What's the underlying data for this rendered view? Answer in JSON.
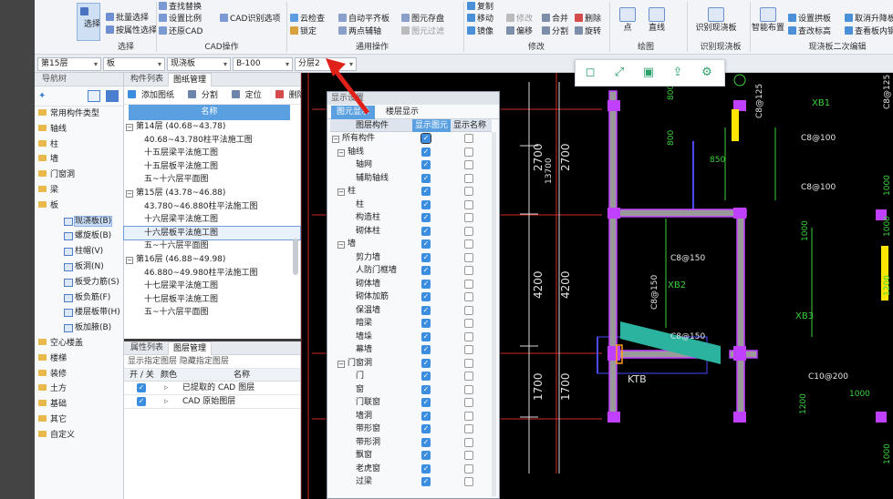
{
  "ribbon": {
    "select": {
      "label": "选择"
    },
    "col1": [
      "批量选择",
      "按属性选择"
    ],
    "col2": [
      "查找替换",
      "设置比例",
      "还原CAD"
    ],
    "col3": [
      "CAD识别选项"
    ],
    "col4": [
      "云检查",
      "锁定"
    ],
    "col5": [
      "自动平齐板",
      "两点辅轴"
    ],
    "col6": [
      "图元存盘",
      "图元过滤"
    ],
    "col7": [
      "复制",
      "移动",
      "镜像"
    ],
    "col8": [
      "修改",
      "偏移"
    ],
    "col9": [
      "合并",
      "分割"
    ],
    "col10": [
      "删除",
      "旋转"
    ],
    "draw": [
      "点",
      "直线"
    ],
    "idslab": "识别现浇板",
    "smart": "智能布置",
    "col11": [
      "设置拱板",
      "查改标高"
    ],
    "col12": [
      "取消升降板",
      "查看板内钢筋"
    ],
    "groups": {
      "select": "选择",
      "cad": "CAD操作",
      "common": "通用操作",
      "modify": "修改",
      "draw": "绘图",
      "idslab": "识别现浇板",
      "slab2": "现浇板二次编辑"
    }
  },
  "toolbar": {
    "floor": "第15层",
    "type": "板",
    "subtype": "现浇板",
    "code": "B-100",
    "layer": "分层2"
  },
  "nav": {
    "title": "导航树",
    "items": [
      "常用构件类型",
      "轴线",
      "柱",
      "墙",
      "门窗洞",
      "梁",
      "板"
    ],
    "slab_children": [
      "现浇板(B)",
      "螺旋板(B)",
      "柱帽(V)",
      "板洞(N)",
      "板受力筋(S)",
      "板负筋(F)",
      "楼层板带(H)",
      "板加腋(B)"
    ],
    "after": [
      "空心楼盖",
      "楼梯",
      "装修",
      "土方",
      "基础",
      "其它",
      "自定义"
    ]
  },
  "comp": {
    "tabs": [
      "构件列表",
      "图纸管理"
    ],
    "tools": [
      "添加图纸",
      "分割",
      "定位",
      "删除"
    ],
    "col": "名称",
    "groups": [
      {
        "name": "第14层 (40.68~43.78)",
        "items": [
          "40.68~43.780柱平法施工图",
          "十五层梁平法施工图",
          "十五层板平法施工图",
          "五~十六层平面图"
        ]
      },
      {
        "name": "第15层 (43.78~46.88)",
        "items": [
          "43.780~46.880柱平法施工图",
          "十六层梁平法施工图",
          "十六层板平法施工图",
          "五~十六层平面图"
        ]
      },
      {
        "name": "第16层 (46.88~49.98)",
        "items": [
          "46.880~49.980柱平法施工图",
          "十七层梁平法施工图",
          "十七层板平法施工图",
          "五~十六层平面图"
        ]
      }
    ]
  },
  "layer": {
    "tabs": [
      "属性列表",
      "图层管理"
    ],
    "links": [
      "显示指定图层",
      "隐藏指定图层"
    ],
    "headers": [
      "开 / 关",
      "颜色",
      "名称"
    ],
    "rows": [
      "已提取的 CAD 图层",
      "CAD 原始图层"
    ]
  },
  "display": {
    "title": "显示设置",
    "tabs": [
      "图元显示",
      "楼层显示"
    ],
    "headers": [
      "图层构件",
      "显示图元",
      "显示名称"
    ],
    "rows": [
      {
        "t": "所有构件",
        "cat": true
      },
      {
        "t": "轴线",
        "cat": true
      },
      {
        "t": "轴网"
      },
      {
        "t": "辅助轴线"
      },
      {
        "t": "柱",
        "cat": true
      },
      {
        "t": "柱"
      },
      {
        "t": "构造柱"
      },
      {
        "t": "砌体柱"
      },
      {
        "t": "墙",
        "cat": true
      },
      {
        "t": "剪力墙"
      },
      {
        "t": "人防门框墙"
      },
      {
        "t": "砌体墙"
      },
      {
        "t": "砌体加筋"
      },
      {
        "t": "保温墙"
      },
      {
        "t": "暗梁"
      },
      {
        "t": "墙垛"
      },
      {
        "t": "幕墙"
      },
      {
        "t": "门窗洞",
        "cat": true
      },
      {
        "t": "门"
      },
      {
        "t": "窗"
      },
      {
        "t": "门联窗"
      },
      {
        "t": "墙洞"
      },
      {
        "t": "带形窗"
      },
      {
        "t": "带形洞"
      },
      {
        "t": "飘窗"
      },
      {
        "t": "老虎窗"
      },
      {
        "t": "过梁"
      }
    ]
  },
  "cad": {
    "labels": {
      "d2700a": "2700",
      "d2700b": "2700",
      "d13": "13700",
      "d4200a": "4200",
      "d4200b": "4200",
      "d1700a": "1700",
      "d1700b": "1700",
      "xb1": "XB1",
      "xb2": "XB2",
      "xb3": "XB3",
      "ktb": "KTB",
      "c8a": "C8@100",
      "c8b": "C8@100",
      "c8c": "C8@150",
      "c8d": "C8@150",
      "c8e": "C8@150",
      "c8f": "C8@125",
      "c8g": "C8@125",
      "c10": "C10@200",
      "y800a": "800",
      "y850": "850",
      "y800b": "800",
      "y1000a": "1000",
      "y1000b": "1000",
      "y1200": "1200",
      "y1000c": "1000",
      "y1000d": "1000",
      "y1200b": "1200",
      "y1000e": "1000"
    }
  },
  "float_tools": [
    "cube-icon",
    "fullscreen-icon",
    "save-icon",
    "share-icon",
    "settings-icon"
  ]
}
